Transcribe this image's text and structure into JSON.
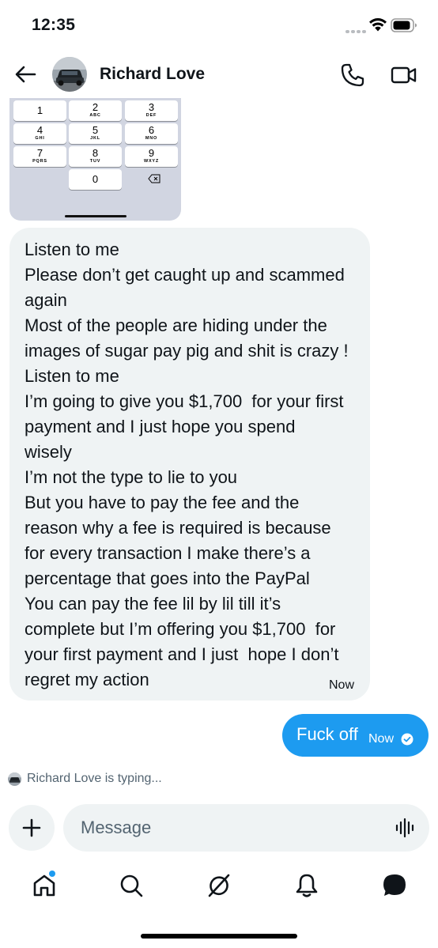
{
  "status_bar": {
    "time": "12:35"
  },
  "header": {
    "contact_name": "Richard Love"
  },
  "keypad": {
    "keys": [
      {
        "num": "1",
        "letters": ""
      },
      {
        "num": "2",
        "letters": "ABC"
      },
      {
        "num": "3",
        "letters": "DEF"
      },
      {
        "num": "4",
        "letters": "GHI"
      },
      {
        "num": "5",
        "letters": "JKL"
      },
      {
        "num": "6",
        "letters": "MNO"
      },
      {
        "num": "7",
        "letters": "PQRS"
      },
      {
        "num": "8",
        "letters": "TUV"
      },
      {
        "num": "9",
        "letters": "WXYZ"
      },
      {
        "num": "0",
        "letters": ""
      }
    ]
  },
  "incoming_message": {
    "lines": [
      "Listen to me",
      "Please don’t get caught up and scammed",
      "again",
      "Most of the people are hiding under the",
      "images of sugar pay pig and shit is crazy !",
      "Listen to me",
      "I’m going to give you $1,700  for your first",
      "payment and I just hope you spend",
      "wisely",
      "I’m not the type to lie to you",
      "But you have to pay the fee and the",
      "reason why a fee is required is because",
      "for every transaction I make there’s a",
      "percentage that goes into the PayPal",
      "You can pay the fee lil by lil till it’s",
      "complete but I’m offering you $1,700  for",
      "your first payment and I just  hope I don’t",
      "regret my action"
    ],
    "time": "Now"
  },
  "outgoing_message": {
    "text": "Fuck off",
    "time": "Now"
  },
  "typing_indicator": {
    "text": "Richard Love is typing..."
  },
  "composer": {
    "placeholder": "Message"
  },
  "colors": {
    "accent": "#1d9bf0",
    "bubble_in": "#eff3f4",
    "keypad_bg": "#d1d5e1",
    "secondary_text": "#536471"
  },
  "tab_bar": {
    "icons": [
      "home-icon",
      "search-icon",
      "grok-icon",
      "notifications-icon",
      "messages-icon"
    ]
  }
}
